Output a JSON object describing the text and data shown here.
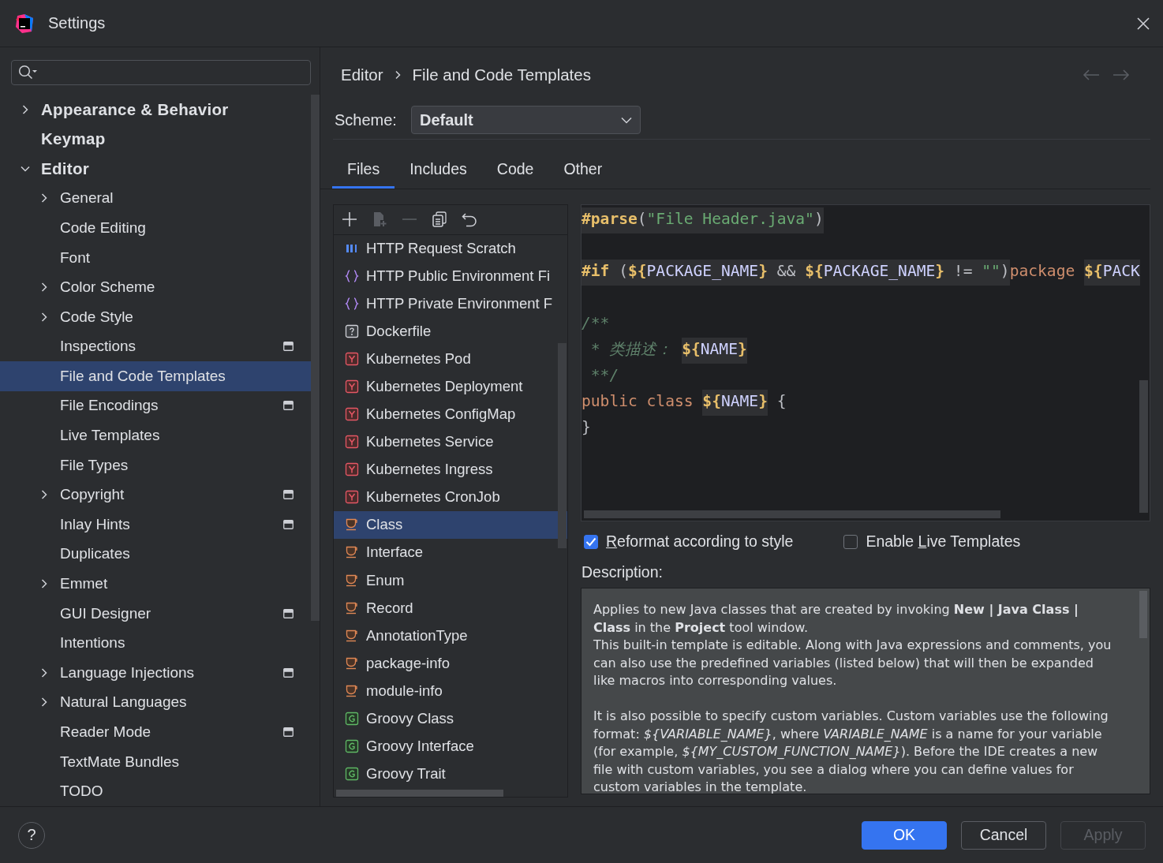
{
  "window": {
    "title": "Settings"
  },
  "sidebar": {
    "items": [
      {
        "label": "Appearance & Behavior",
        "kind": "folder",
        "expanded": false,
        "selected": false,
        "project_level": false
      },
      {
        "label": "Keymap",
        "kind": "leaf",
        "selected": false,
        "project_level": false
      },
      {
        "label": "Editor",
        "kind": "folder",
        "expanded": true,
        "selected": false,
        "project_level": false,
        "children": [
          {
            "label": "General",
            "kind": "folder",
            "expanded": false,
            "selected": false,
            "project_level": false
          },
          {
            "label": "Code Editing",
            "kind": "leaf",
            "selected": false,
            "project_level": false
          },
          {
            "label": "Font",
            "kind": "leaf",
            "selected": false,
            "project_level": false
          },
          {
            "label": "Color Scheme",
            "kind": "folder",
            "expanded": false,
            "selected": false,
            "project_level": false
          },
          {
            "label": "Code Style",
            "kind": "folder",
            "expanded": false,
            "selected": false,
            "project_level": false
          },
          {
            "label": "Inspections",
            "kind": "leaf",
            "selected": false,
            "project_level": true
          },
          {
            "label": "File and Code Templates",
            "kind": "leaf",
            "selected": true,
            "project_level": false
          },
          {
            "label": "File Encodings",
            "kind": "leaf",
            "selected": false,
            "project_level": true
          },
          {
            "label": "Live Templates",
            "kind": "leaf",
            "selected": false,
            "project_level": false
          },
          {
            "label": "File Types",
            "kind": "leaf",
            "selected": false,
            "project_level": false
          },
          {
            "label": "Copyright",
            "kind": "folder",
            "expanded": false,
            "selected": false,
            "project_level": true
          },
          {
            "label": "Inlay Hints",
            "kind": "leaf",
            "selected": false,
            "project_level": true
          },
          {
            "label": "Duplicates",
            "kind": "leaf",
            "selected": false,
            "project_level": false
          },
          {
            "label": "Emmet",
            "kind": "folder",
            "expanded": false,
            "selected": false,
            "project_level": false
          },
          {
            "label": "GUI Designer",
            "kind": "leaf",
            "selected": false,
            "project_level": true
          },
          {
            "label": "Intentions",
            "kind": "leaf",
            "selected": false,
            "project_level": false
          },
          {
            "label": "Language Injections",
            "kind": "folder",
            "expanded": false,
            "selected": false,
            "project_level": true
          },
          {
            "label": "Natural Languages",
            "kind": "folder",
            "expanded": false,
            "selected": false,
            "project_level": false
          },
          {
            "label": "Reader Mode",
            "kind": "leaf",
            "selected": false,
            "project_level": true
          },
          {
            "label": "TextMate Bundles",
            "kind": "leaf",
            "selected": false,
            "project_level": false
          },
          {
            "label": "TODO",
            "kind": "leaf",
            "selected": false,
            "project_level": false
          }
        ]
      }
    ]
  },
  "breadcrumb": [
    "Editor",
    "File and Code Templates"
  ],
  "scheme": {
    "label": "Scheme:",
    "value": "Default"
  },
  "tabs": [
    {
      "label": "Files",
      "selected": true
    },
    {
      "label": "Includes",
      "selected": false
    },
    {
      "label": "Code",
      "selected": false
    },
    {
      "label": "Other",
      "selected": false
    }
  ],
  "toolbar": [
    {
      "kind": "add",
      "disabled": false
    },
    {
      "kind": "add-child",
      "disabled": true
    },
    {
      "kind": "remove",
      "disabled": true
    },
    {
      "kind": "copy",
      "disabled": false
    },
    {
      "kind": "reset",
      "disabled": false
    }
  ],
  "templates": [
    {
      "label": "HTTP Request Scratch",
      "kind": "api",
      "selected": false
    },
    {
      "label": "HTTP Public Environment Fi",
      "kind": "json",
      "selected": false
    },
    {
      "label": "HTTP Private Environment F",
      "kind": "json",
      "selected": false
    },
    {
      "label": "Dockerfile",
      "kind": "unknown",
      "selected": false
    },
    {
      "label": "Kubernetes Pod",
      "kind": "yaml",
      "selected": false
    },
    {
      "label": "Kubernetes Deployment",
      "kind": "yaml",
      "selected": false
    },
    {
      "label": "Kubernetes ConfigMap",
      "kind": "yaml",
      "selected": false
    },
    {
      "label": "Kubernetes Service",
      "kind": "yaml",
      "selected": false
    },
    {
      "label": "Kubernetes Ingress",
      "kind": "yaml",
      "selected": false
    },
    {
      "label": "Kubernetes CronJob",
      "kind": "yaml",
      "selected": false
    },
    {
      "label": "Class",
      "kind": "java",
      "selected": true
    },
    {
      "label": "Interface",
      "kind": "java",
      "selected": false
    },
    {
      "label": "Enum",
      "kind": "java",
      "selected": false
    },
    {
      "label": "Record",
      "kind": "java",
      "selected": false
    },
    {
      "label": "AnnotationType",
      "kind": "java",
      "selected": false
    },
    {
      "label": "package-info",
      "kind": "java",
      "selected": false
    },
    {
      "label": "module-info",
      "kind": "java",
      "selected": false
    },
    {
      "label": "Groovy Class",
      "kind": "groovy",
      "selected": false
    },
    {
      "label": "Groovy Interface",
      "kind": "groovy",
      "selected": false
    },
    {
      "label": "Groovy Trait",
      "kind": "groovy",
      "selected": false
    }
  ],
  "editor": {
    "lines": [
      {
        "kind": "code",
        "tokens": [
          {
            "text": "#parse",
            "kind": "directive",
            "highlight": true
          },
          {
            "text": "(",
            "kind": "plain",
            "highlight": true
          },
          {
            "text": "\"File Header.java\"",
            "kind": "string",
            "highlight": true
          },
          {
            "text": ")",
            "kind": "plain",
            "highlight": true
          }
        ]
      },
      {
        "kind": "blank"
      },
      {
        "kind": "code",
        "tokens": [
          {
            "text": "#if",
            "kind": "directive",
            "highlight": true
          },
          {
            "text": " (",
            "kind": "plain",
            "highlight": true
          },
          {
            "text": "${",
            "kind": "var-brace",
            "highlight": true
          },
          {
            "text": "PACKAGE_NAME",
            "kind": "var-name",
            "highlight": true
          },
          {
            "text": "}",
            "kind": "var-brace",
            "highlight": true
          },
          {
            "text": " && ",
            "kind": "plain",
            "highlight": true
          },
          {
            "text": "${",
            "kind": "var-brace",
            "highlight": true
          },
          {
            "text": "PACKAGE_NAME",
            "kind": "var-name",
            "highlight": true
          },
          {
            "text": "}",
            "kind": "var-brace",
            "highlight": true
          },
          {
            "text": " != ",
            "kind": "plain",
            "highlight": true
          },
          {
            "text": "\"\"",
            "kind": "string",
            "highlight": true
          },
          {
            "text": ")",
            "kind": "plain",
            "highlight": true
          },
          {
            "text": "package ",
            "kind": "keyword",
            "highlight": false
          },
          {
            "text": "${",
            "kind": "var-brace",
            "highlight": true
          },
          {
            "text": "PACK",
            "kind": "var-name",
            "highlight": true
          }
        ]
      },
      {
        "kind": "blank"
      },
      {
        "kind": "code",
        "tokens": [
          {
            "text": "/**",
            "kind": "comment",
            "highlight": false
          }
        ]
      },
      {
        "kind": "code",
        "tokens": [
          {
            "text": " * ",
            "kind": "comment",
            "highlight": false
          },
          {
            "text": "类描述： ",
            "kind": "comment",
            "highlight": false
          },
          {
            "text": "${",
            "kind": "var-brace",
            "highlight": true
          },
          {
            "text": "NAME",
            "kind": "var-name",
            "highlight": true
          },
          {
            "text": "}",
            "kind": "var-brace",
            "highlight": true
          }
        ]
      },
      {
        "kind": "code",
        "tokens": [
          {
            "text": " **/",
            "kind": "comment",
            "highlight": false
          }
        ]
      },
      {
        "kind": "code",
        "tokens": [
          {
            "text": "public class ",
            "kind": "keyword",
            "highlight": false
          },
          {
            "text": "${",
            "kind": "var-brace",
            "highlight": true
          },
          {
            "text": "NAME",
            "kind": "var-name",
            "highlight": true
          },
          {
            "text": "}",
            "kind": "var-brace",
            "highlight": true
          },
          {
            "text": " {",
            "kind": "plain",
            "highlight": false
          }
        ]
      },
      {
        "kind": "code",
        "tokens": [
          {
            "text": "}",
            "kind": "plain",
            "highlight": false
          }
        ]
      }
    ]
  },
  "options": [
    {
      "mnemonic": "R",
      "after": "eformat according to style",
      "checked": true
    },
    {
      "before": "Enable ",
      "mnemonic": "L",
      "after": "ive Templates",
      "checked": false
    }
  ],
  "description": {
    "label": "Description:",
    "paragraphs": [
      [
        "Applies to new Java classes that are created by invoking **New | Java Class | Class** in the **Project** tool window.",
        "This built-in template is editable. Along with Java expressions and comments, you can also use the predefined variables (listed below) that will then be expanded like macros into corresponding values."
      ],
      [
        "It is also possible to specify custom variables. Custom variables use the following format: *${VARIABLE_NAME}*, where *VARIABLE_NAME* is a name for your variable (for example, *${MY_CUSTOM_FUNCTION_NAME}*). Before the IDE creates a new file with custom variables, you see a dialog where you can define values for custom variables in the template."
      ]
    ]
  },
  "help_button": "?",
  "buttons": [
    {
      "label": "OK",
      "kind": "primary",
      "disabled": false
    },
    {
      "label": "Cancel",
      "kind": "normal",
      "disabled": false
    },
    {
      "label": "Apply",
      "kind": "normal",
      "disabled": true
    }
  ]
}
